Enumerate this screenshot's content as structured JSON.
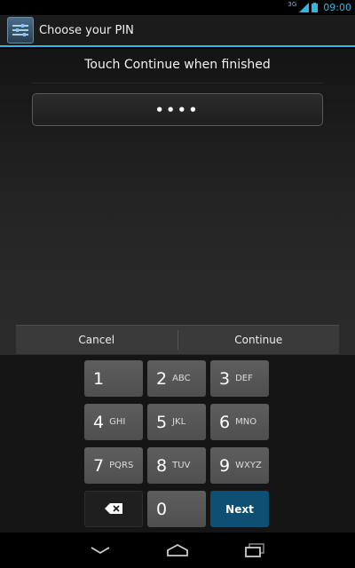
{
  "status_bar": {
    "network": "3G",
    "time": "09:00"
  },
  "action_bar": {
    "title": "Choose your PIN",
    "icon": "settings-sliders-icon"
  },
  "main": {
    "instruction": "Touch Continue when finished",
    "pin_masked": "••••"
  },
  "buttons": {
    "cancel": "Cancel",
    "continue": "Continue"
  },
  "keypad": {
    "keys": [
      {
        "num": "1",
        "letters": ""
      },
      {
        "num": "2",
        "letters": "ABC"
      },
      {
        "num": "3",
        "letters": "DEF"
      },
      {
        "num": "4",
        "letters": "GHI"
      },
      {
        "num": "5",
        "letters": "JKL"
      },
      {
        "num": "6",
        "letters": "MNO"
      },
      {
        "num": "7",
        "letters": "PQRS"
      },
      {
        "num": "8",
        "letters": "TUV"
      },
      {
        "num": "9",
        "letters": "WXYZ"
      },
      {
        "num": "0",
        "letters": ""
      }
    ],
    "next_label": "Next"
  },
  "colors": {
    "accent": "#33b5e5",
    "next_key": "#0f4f73"
  }
}
